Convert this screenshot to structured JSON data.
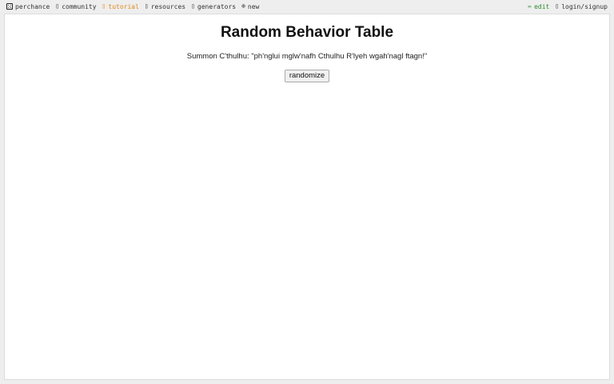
{
  "topbar": {
    "left": [
      {
        "name": "perchance",
        "icon": "dice-icon",
        "label": "perchance"
      },
      {
        "name": "community",
        "icon": "community-icon",
        "label": "community"
      },
      {
        "name": "tutorial",
        "icon": "tutorial-icon",
        "label": "tutorial",
        "color": "#e08a1e"
      },
      {
        "name": "resources",
        "icon": "resources-icon",
        "label": "resources"
      },
      {
        "name": "generators",
        "icon": "generators-icon",
        "label": "generators"
      },
      {
        "name": "new",
        "icon": "plus-circle-icon",
        "label": "new"
      }
    ],
    "right": [
      {
        "name": "edit",
        "icon": "pencil-icon",
        "label": "edit",
        "color": "#2e8b2e"
      },
      {
        "name": "login",
        "icon": "user-icon",
        "label": "login/signup"
      }
    ]
  },
  "main": {
    "title": "Random Behavior Table",
    "output": "Summon C'thulhu: \"ph'nglui mglw'nafh Cthulhu R'lyeh wgah'nagl ftagn!\"",
    "button_label": "randomize"
  }
}
